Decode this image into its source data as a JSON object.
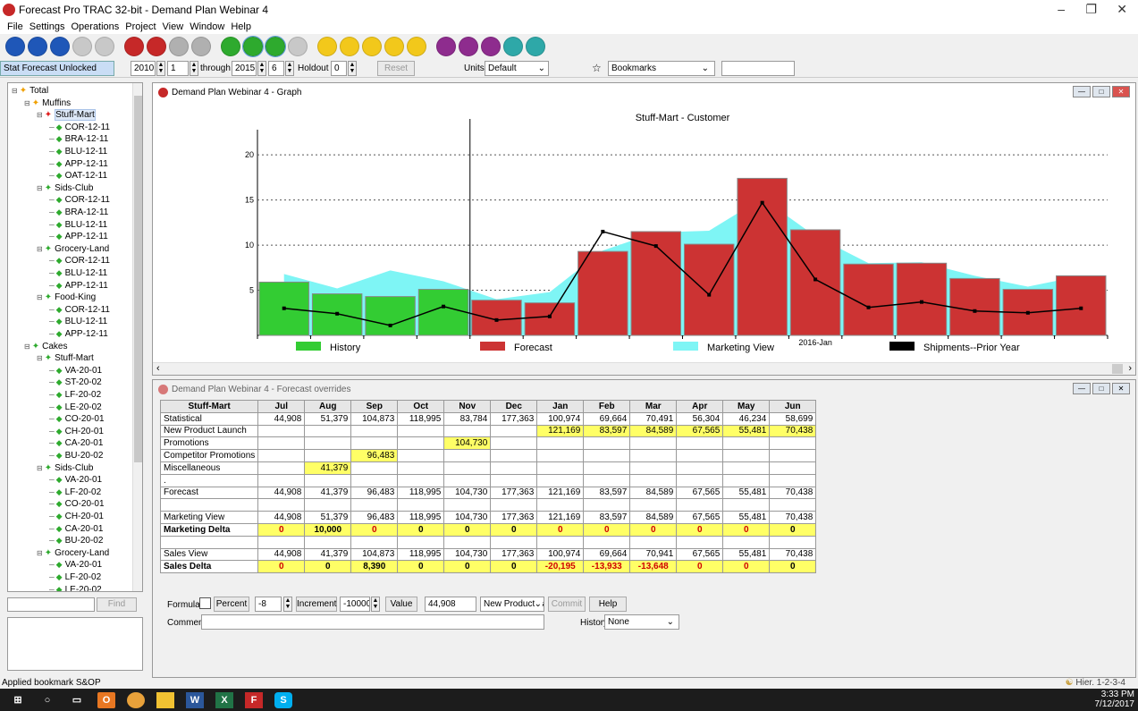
{
  "window": {
    "title": "Forecast Pro TRAC 32-bit - Demand Plan Webinar 4"
  },
  "menu": [
    "File",
    "Settings",
    "Operations",
    "Project",
    "View",
    "Window",
    "Help"
  ],
  "toolbar": [
    {
      "icon": "open-project-icon",
      "color": "#1f57b8"
    },
    {
      "icon": "save-project-icon",
      "color": "#1f57b8"
    },
    {
      "icon": "save-as-icon",
      "color": "#1f57b8"
    },
    {
      "icon": "close-project-icon",
      "color": "#c8c8c8"
    },
    {
      "icon": "print-icon",
      "color": "#c8c8c8"
    },
    {
      "icon": "database-icon",
      "color": "#c62828"
    },
    {
      "icon": "pie-chart-icon",
      "color": "#c62828"
    },
    {
      "icon": "forecast-check-icon",
      "color": "#b0b0b0"
    },
    {
      "icon": "refresh-icon",
      "color": "#b0b0b0"
    },
    {
      "icon": "report-icon",
      "color": "#2eaa2e"
    },
    {
      "icon": "graph-icon",
      "color": "#2eaa2e",
      "selected": true
    },
    {
      "icon": "graph-compare-icon",
      "color": "#2eaa2e",
      "selected": true
    },
    {
      "icon": "paw-icon",
      "color": "#c8c8c8"
    },
    {
      "icon": "notes-icon",
      "color": "#f2c81b"
    },
    {
      "icon": "filter-icon",
      "color": "#f2c81b"
    },
    {
      "icon": "pencil-icon",
      "color": "#f2c81b"
    },
    {
      "icon": "edit-icon",
      "color": "#f2c81b"
    },
    {
      "icon": "hash-icon",
      "color": "#f2c81b"
    },
    {
      "icon": "export-icon",
      "color": "#8e2c8e"
    },
    {
      "icon": "people-icon",
      "color": "#8e2c8e"
    },
    {
      "icon": "stop-icon",
      "color": "#8e2c8e"
    },
    {
      "icon": "funnel-icon",
      "color": "#2ea8a8"
    },
    {
      "icon": "tools-icon",
      "color": "#2ea8a8"
    }
  ],
  "options": {
    "status": "Stat Forecast Unlocked",
    "from_year": "2010",
    "from_period": "1",
    "through_label": "through",
    "to_year": "2015",
    "to_period": "6",
    "holdout_label": "Holdout",
    "holdout": "0",
    "reset_label": "Reset",
    "units_label": "Units",
    "units_value": "Default",
    "bookmarks_value": "Bookmarks"
  },
  "tree": [
    {
      "label": "Total",
      "level": 0,
      "star": "#f0a000",
      "ex": "⊟"
    },
    {
      "label": "Muffins",
      "level": 1,
      "star": "#f0a000",
      "ex": "⊟"
    },
    {
      "label": "Stuff-Mart",
      "level": 2,
      "star": "#e02020",
      "ex": "⊟",
      "selected": true
    },
    {
      "label": "COR-12-11",
      "level": 3
    },
    {
      "label": "BRA-12-11",
      "level": 3
    },
    {
      "label": "BLU-12-11",
      "level": 3
    },
    {
      "label": "APP-12-11",
      "level": 3
    },
    {
      "label": "OAT-12-11",
      "level": 3
    },
    {
      "label": "Sids-Club",
      "level": 2,
      "star": "#2eaa2e",
      "ex": "⊟"
    },
    {
      "label": "COR-12-11",
      "level": 3
    },
    {
      "label": "BRA-12-11",
      "level": 3
    },
    {
      "label": "BLU-12-11",
      "level": 3
    },
    {
      "label": "APP-12-11",
      "level": 3
    },
    {
      "label": "Grocery-Land",
      "level": 2,
      "star": "#2eaa2e",
      "ex": "⊟"
    },
    {
      "label": "COR-12-11",
      "level": 3
    },
    {
      "label": "BLU-12-11",
      "level": 3
    },
    {
      "label": "APP-12-11",
      "level": 3
    },
    {
      "label": "Food-King",
      "level": 2,
      "star": "#2eaa2e",
      "ex": "⊟"
    },
    {
      "label": "COR-12-11",
      "level": 3
    },
    {
      "label": "BLU-12-11",
      "level": 3
    },
    {
      "label": "APP-12-11",
      "level": 3
    },
    {
      "label": "Cakes",
      "level": 1,
      "star": "#2eaa2e",
      "ex": "⊟"
    },
    {
      "label": "Stuff-Mart",
      "level": 2,
      "star": "#2eaa2e",
      "ex": "⊟"
    },
    {
      "label": "VA-20-01",
      "level": 3
    },
    {
      "label": "ST-20-02",
      "level": 3
    },
    {
      "label": "LF-20-02",
      "level": 3
    },
    {
      "label": "LE-20-02",
      "level": 3
    },
    {
      "label": "CO-20-01",
      "level": 3
    },
    {
      "label": "CH-20-01",
      "level": 3
    },
    {
      "label": "CA-20-01",
      "level": 3
    },
    {
      "label": "BU-20-02",
      "level": 3
    },
    {
      "label": "Sids-Club",
      "level": 2,
      "star": "#2eaa2e",
      "ex": "⊟"
    },
    {
      "label": "VA-20-01",
      "level": 3
    },
    {
      "label": "LF-20-02",
      "level": 3
    },
    {
      "label": "CO-20-01",
      "level": 3
    },
    {
      "label": "CH-20-01",
      "level": 3
    },
    {
      "label": "CA-20-01",
      "level": 3
    },
    {
      "label": "BU-20-02",
      "level": 3
    },
    {
      "label": "Grocery-Land",
      "level": 2,
      "star": "#2eaa2e",
      "ex": "⊟"
    },
    {
      "label": "VA-20-01",
      "level": 3
    },
    {
      "label": "LF-20-02",
      "level": 3
    },
    {
      "label": "LE-20-02",
      "level": 3
    }
  ],
  "find_label": "Find",
  "graph_window": {
    "title": "Demand Plan Webinar 4 - Graph"
  },
  "chart_data": {
    "type": "bar",
    "title": "Stuff-Mart - Customer",
    "ylim": [
      0,
      22
    ],
    "yticks": [
      5,
      10,
      15,
      20
    ],
    "grid": "horizontal dotted",
    "x_tick_label": "2016-Jan",
    "x_tick_index": 10,
    "cursor_index": 3.5,
    "legend_position": "bottom",
    "series": [
      {
        "name": "History",
        "type": "bar",
        "color": "#33cc33",
        "values": [
          5.9,
          4.6,
          4.3,
          5.1,
          null,
          null,
          null,
          null,
          null,
          null,
          null,
          null,
          null,
          null,
          null,
          null
        ]
      },
      {
        "name": "Forecast",
        "type": "bar",
        "color": "#cc3333",
        "values": [
          null,
          null,
          null,
          null,
          3.9,
          3.6,
          9.3,
          11.5,
          10.1,
          17.4,
          11.7,
          7.9,
          8.0,
          6.3,
          5.1,
          6.6
        ]
      },
      {
        "name": "Marketing View",
        "type": "area",
        "color": "#7ef5f5",
        "values": [
          6.8,
          5.2,
          7.2,
          6.0,
          4.0,
          4.8,
          9.4,
          11.4,
          11.6,
          15.2,
          11.0,
          8.0,
          8.1,
          6.6,
          5.4,
          6.6
        ]
      },
      {
        "name": "Shipments--Prior Year",
        "type": "line",
        "color": "#000000",
        "values": [
          3.0,
          2.4,
          1.1,
          3.2,
          1.7,
          2.1,
          11.5,
          9.9,
          4.5,
          14.7,
          6.2,
          3.1,
          3.7,
          2.7,
          2.5,
          3.0
        ]
      }
    ]
  },
  "grid_window": {
    "title": "Demand Plan Webinar 4 - Forecast overrides"
  },
  "grid": {
    "corner": "Stuff-Mart",
    "columns": [
      "Jul",
      "Aug",
      "Sep",
      "Oct",
      "Nov",
      "Dec",
      "Jan",
      "Feb",
      "Mar",
      "Apr",
      "May",
      "Jun"
    ],
    "rows": [
      {
        "label": "Statistical",
        "cells": [
          "44,908",
          "51,379",
          "104,873",
          "118,995",
          "83,784",
          "177,363",
          "100,974",
          "69,664",
          "70,491",
          "56,304",
          "46,234",
          "58,699"
        ]
      },
      {
        "label": "New Product Launch",
        "cells": [
          "",
          "",
          "",
          "",
          "",
          "",
          "121,169",
          "83,597",
          "84,589",
          "67,565",
          "55,481",
          "70,438"
        ],
        "hl": [
          6,
          7,
          8,
          9,
          10,
          11
        ]
      },
      {
        "label": "Promotions",
        "cells": [
          "",
          "",
          "",
          "",
          "104,730",
          "",
          "",
          "",
          "",
          "",
          "",
          ""
        ],
        "hl": [
          4
        ]
      },
      {
        "label": "Competitor Promotions",
        "cells": [
          "",
          "",
          "96,483",
          "",
          "",
          "",
          "",
          "",
          "",
          "",
          "",
          ""
        ],
        "hl": [
          2
        ]
      },
      {
        "label": "Miscellaneous",
        "cells": [
          "",
          "41,379",
          "",
          "",
          "",
          "",
          "",
          "",
          "",
          "",
          "",
          ""
        ],
        "hl": [
          1
        ]
      },
      {
        "label": ".",
        "cells": [
          "",
          "",
          "",
          "",
          "",
          "",
          "",
          "",
          "",
          "",
          "",
          ""
        ]
      },
      {
        "label": "Forecast",
        "cells": [
          "44,908",
          "41,379",
          "96,483",
          "118,995",
          "104,730",
          "177,363",
          "121,169",
          "83,597",
          "84,589",
          "67,565",
          "55,481",
          "70,438"
        ]
      },
      {
        "label": "",
        "cells": [
          "",
          "",
          "",
          "",
          "",
          "",
          "",
          "",
          "",
          "",
          "",
          ""
        ]
      },
      {
        "label": "Marketing View",
        "cells": [
          "44,908",
          "51,379",
          "96,483",
          "118,995",
          "104,730",
          "177,363",
          "121,169",
          "83,597",
          "84,589",
          "67,565",
          "55,481",
          "70,438"
        ]
      },
      {
        "label": "Marketing Delta",
        "bold": true,
        "delta": true,
        "cells": [
          "0",
          "10,000",
          "0",
          "0",
          "0",
          "0",
          "0",
          "0",
          "0",
          "0",
          "0",
          "0"
        ],
        "red": [
          0,
          2,
          6,
          7,
          8,
          9,
          10
        ]
      },
      {
        "label": "",
        "cells": [
          "",
          "",
          "",
          "",
          "",
          "",
          "",
          "",
          "",
          "",
          "",
          ""
        ]
      },
      {
        "label": "Sales View",
        "cells": [
          "44,908",
          "41,379",
          "104,873",
          "118,995",
          "104,730",
          "177,363",
          "100,974",
          "69,664",
          "70,941",
          "67,565",
          "55,481",
          "70,438"
        ]
      },
      {
        "label": "Sales Delta",
        "bold": true,
        "delta": true,
        "cells": [
          "0",
          "0",
          "8,390",
          "0",
          "0",
          "0",
          "-20,195",
          "-13,933",
          "-13,648",
          "0",
          "0",
          "0"
        ],
        "red": [
          0,
          6,
          7,
          8,
          9,
          10
        ]
      }
    ]
  },
  "controls": {
    "formulas_label": "Formulas",
    "percent_label": "Percent",
    "percent_value": "-8",
    "increment_label": "Increment",
    "increment_value": "-10000",
    "value_label": "Value",
    "value_value": "44,908",
    "row_select": "New Product La",
    "commit_label": "Commit",
    "help_label": "Help",
    "comment_label": "Comment:",
    "history_label": "History",
    "history_value": "None"
  },
  "status": {
    "left": "Applied bookmark S&OP",
    "right": "Hier. 1-2-3-4"
  },
  "taskbar": {
    "time": "3:33 PM",
    "date": "7/12/2017"
  }
}
